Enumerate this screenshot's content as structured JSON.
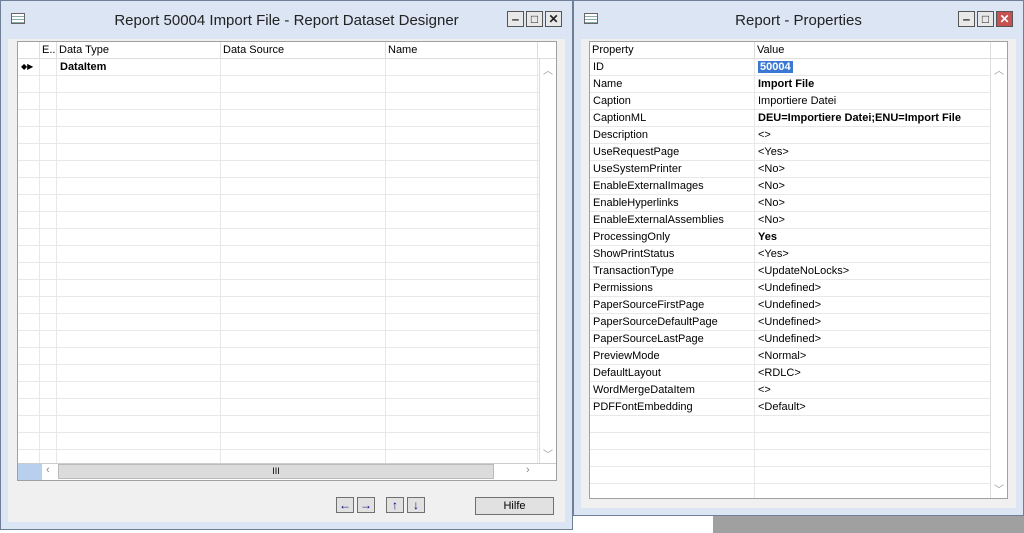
{
  "designer": {
    "title": "Report 50004 Import File - Report Dataset Designer",
    "columns": [
      "E..",
      "Data Type",
      "Data Source",
      "Name"
    ],
    "rows": [
      {
        "indicator": "◆▶",
        "data_type": "DataItem",
        "data_source": "",
        "name": ""
      }
    ],
    "help_label": "Hilfe",
    "nav": {
      "left": "←",
      "right": "→",
      "up": "↑",
      "down": "↓"
    },
    "scroll_thumb": "III"
  },
  "properties": {
    "title": "Report - Properties",
    "columns": [
      "Property",
      "Value"
    ],
    "rows": [
      {
        "p": "ID",
        "v": "50004",
        "selected": true
      },
      {
        "p": "Name",
        "v": "Import File",
        "bold": true
      },
      {
        "p": "Caption",
        "v": "Importiere Datei"
      },
      {
        "p": "CaptionML",
        "v": "DEU=Importiere Datei;ENU=Import File",
        "bold": true
      },
      {
        "p": "Description",
        "v": "<>"
      },
      {
        "p": "UseRequestPage",
        "v": "<Yes>"
      },
      {
        "p": "UseSystemPrinter",
        "v": "<No>"
      },
      {
        "p": "EnableExternalImages",
        "v": "<No>"
      },
      {
        "p": "EnableHyperlinks",
        "v": "<No>"
      },
      {
        "p": "EnableExternalAssemblies",
        "v": "<No>"
      },
      {
        "p": "ProcessingOnly",
        "v": "Yes",
        "bold": true
      },
      {
        "p": "ShowPrintStatus",
        "v": "<Yes>"
      },
      {
        "p": "TransactionType",
        "v": "<UpdateNoLocks>"
      },
      {
        "p": "Permissions",
        "v": "<Undefined>"
      },
      {
        "p": "PaperSourceFirstPage",
        "v": "<Undefined>"
      },
      {
        "p": "PaperSourceDefaultPage",
        "v": "<Undefined>"
      },
      {
        "p": "PaperSourceLastPage",
        "v": "<Undefined>"
      },
      {
        "p": "PreviewMode",
        "v": "<Normal>"
      },
      {
        "p": "DefaultLayout",
        "v": "<RDLC>"
      },
      {
        "p": "WordMergeDataItem",
        "v": "<>"
      },
      {
        "p": "PDFFontEmbedding",
        "v": "<Default>"
      }
    ]
  }
}
